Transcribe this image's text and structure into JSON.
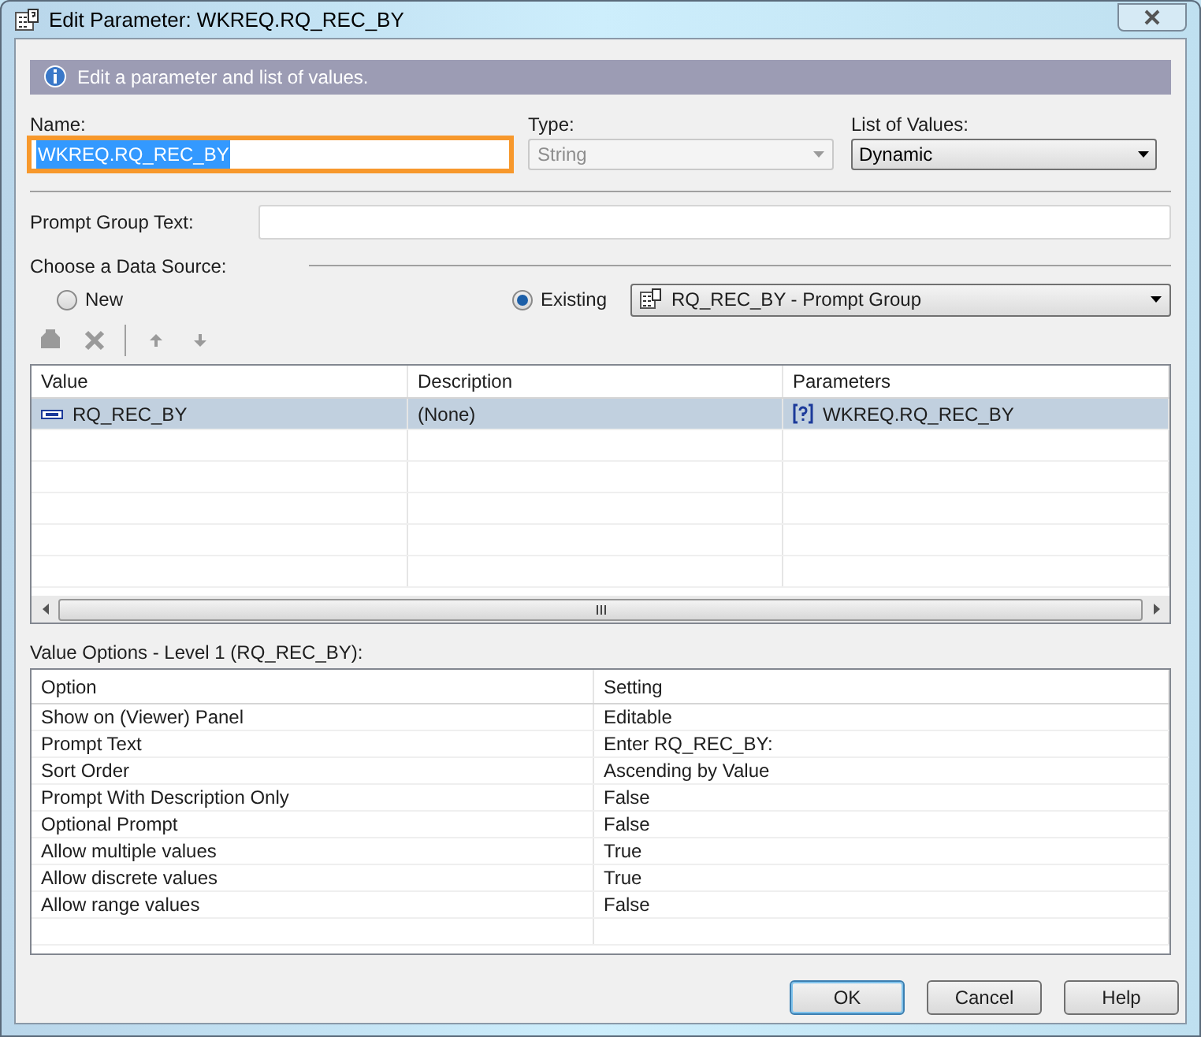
{
  "window": {
    "title": "Edit Parameter: WKREQ.RQ_REC_BY"
  },
  "banner": {
    "text": "Edit a parameter and list of values."
  },
  "name": {
    "label": "Name:",
    "value": "WKREQ.RQ_REC_BY",
    "text_selected": true
  },
  "type": {
    "label": "Type:",
    "value": "String",
    "disabled": true
  },
  "list_of_values": {
    "label": "List of Values:",
    "value": "Dynamic",
    "disabled": false
  },
  "prompt_group_text": {
    "label": "Prompt Group Text:"
  },
  "data_source": {
    "label": "Choose a Data Source:",
    "options": [
      {
        "label": "New",
        "selected": false
      },
      {
        "label": "Existing",
        "selected": true
      }
    ],
    "existing_value": "RQ_REC_BY - Prompt Group"
  },
  "toolbar": [
    {
      "kind": "add",
      "disabled": true
    },
    {
      "kind": "delete",
      "disabled": true
    },
    {
      "kind": "separator"
    },
    {
      "kind": "up",
      "disabled": true
    },
    {
      "kind": "down",
      "disabled": true
    }
  ],
  "values_table": {
    "columns": [
      "Value",
      "Description",
      "Parameters"
    ],
    "rows": [
      {
        "value": "RQ_REC_BY",
        "description": "(None)",
        "parameters": "WKREQ.RQ_REC_BY",
        "selected": true
      }
    ]
  },
  "value_options": {
    "label": "Value Options - Level 1 (RQ_REC_BY):",
    "columns": [
      "Option",
      "Setting"
    ],
    "rows": [
      {
        "option": "Show on (Viewer) Panel",
        "setting": "Editable"
      },
      {
        "option": "Prompt Text",
        "setting": "Enter RQ_REC_BY:"
      },
      {
        "option": "Sort Order",
        "setting": "Ascending by Value"
      },
      {
        "option": "Prompt With Description Only",
        "setting": "False"
      },
      {
        "option": "Optional Prompt",
        "setting": "False"
      },
      {
        "option": "Allow multiple values",
        "setting": "True"
      },
      {
        "option": "Allow discrete values",
        "setting": "True"
      },
      {
        "option": "Allow range values",
        "setting": "False"
      }
    ]
  },
  "buttons": [
    {
      "label": "OK",
      "default": true
    },
    {
      "label": "Cancel",
      "default": false
    },
    {
      "label": "Help",
      "default": false
    }
  ]
}
